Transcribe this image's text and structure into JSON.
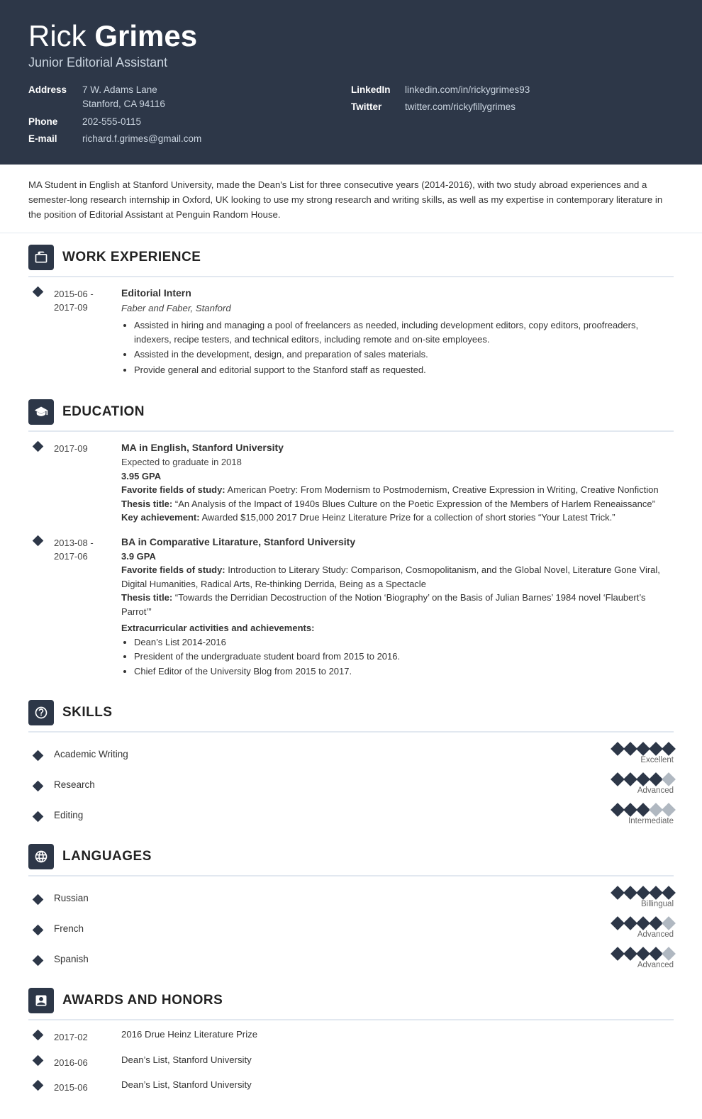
{
  "header": {
    "first_name": "Rick ",
    "last_name": "Grimes",
    "title": "Junior Editorial Assistant",
    "address_label": "Address",
    "address_line1": "7 W. Adams Lane",
    "address_line2": "Stanford, CA 94116",
    "phone_label": "Phone",
    "phone": "202-555-0115",
    "email_label": "E-mail",
    "email": "richard.f.grimes@gmail.com",
    "linkedin_label": "LinkedIn",
    "linkedin": "linkedin.com/in/rickygrimes93",
    "twitter_label": "Twitter",
    "twitter": "twitter.com/rickyfillygrimes"
  },
  "summary": "MA Student in English at Stanford University, made the Dean's List for three consecutive years (2014-2016), with two study abroad experiences and a semester-long research internship in Oxford, UK looking to use my strong research and writing skills, as well as my expertise in contemporary literature in the position of Editorial Assistant at Penguin Random House.",
  "work_experience": {
    "section_title": "WORK EXPERIENCE",
    "entries": [
      {
        "date": "2015-06 -\n2017-09",
        "job_title": "Editorial Intern",
        "company": "Faber and Faber, Stanford",
        "bullets": [
          "Assisted in hiring and managing a pool of freelancers as needed, including development editors, copy editors, proofreaders, indexers, recipe testers, and technical editors, including remote and on-site employees.",
          "Assisted in the development, design, and preparation of sales materials.",
          "Provide general and editorial support to the Stanford staff as requested."
        ]
      }
    ]
  },
  "education": {
    "section_title": "EDUCATION",
    "entries": [
      {
        "date": "2017-09",
        "degree": "MA in English, Stanford University",
        "note": "Expected to graduate in 2018",
        "gpa": "3.95 GPA",
        "fields_label": "Favorite fields of study:",
        "fields": "American Poetry: From Modernism to Postmodernism, Creative Expression in Writing, Creative Nonfiction",
        "thesis_label": "Thesis title:",
        "thesis": "“An Analysis of the Impact of 1940s Blues Culture on the Poetic Expression of the Members of Harlem Reneaissance”",
        "achievement_label": "Key achievement:",
        "achievement": "Awarded $15,000 2017 Drue Heinz Literature Prize for a collection of short stories “Your Latest Trick.”",
        "extra_title": null,
        "extra_bullets": []
      },
      {
        "date": "2013-08 -\n2017-06",
        "degree": "BA in Comparative Litarature, Stanford University",
        "note": null,
        "gpa": "3.9 GPA",
        "fields_label": "Favorite fields of study:",
        "fields": "Introduction to Literary Study: Comparison, Cosmopolitanism, and the Global Novel, Literature Gone Viral, Digital Humanities, Radical Arts, Re-thinking Derrida, Being as a Spectacle",
        "thesis_label": "Thesis title:",
        "thesis": "“Towards the Derridian Decostruction of the Notion ‘Biography’ on the Basis of Julian Barnes’ 1984 novel ‘Flaubert’s Parrot’”",
        "extra_title": "Extracurricular activities and achievements:",
        "extra_bullets": [
          "Dean’s List 2014-2016",
          "President of the undergraduate student board from 2015 to 2016.",
          "Chief Editor of the University Blog from 2015 to 2017."
        ]
      }
    ]
  },
  "skills": {
    "section_title": "SKILLS",
    "entries": [
      {
        "name": "Academic Writing",
        "filled": 5,
        "total": 5,
        "label": "Excellent"
      },
      {
        "name": "Research",
        "filled": 4,
        "total": 5,
        "label": "Advanced"
      },
      {
        "name": "Editing",
        "filled": 3,
        "total": 5,
        "label": "Intermediate"
      }
    ]
  },
  "languages": {
    "section_title": "LANGUAGES",
    "entries": [
      {
        "name": "Russian",
        "filled": 5,
        "total": 5,
        "label": "Billingual"
      },
      {
        "name": "French",
        "filled": 4,
        "total": 5,
        "label": "Advanced"
      },
      {
        "name": "Spanish",
        "filled": 4,
        "total": 5,
        "label": "Advanced"
      }
    ]
  },
  "awards": {
    "section_title": "AWARDS AND HONORS",
    "entries": [
      {
        "date": "2017-02",
        "name": "2016 Drue Heinz Literature Prize"
      },
      {
        "date": "2016-06",
        "name": "Dean’s List, Stanford University"
      },
      {
        "date": "2015-06",
        "name": "Dean’s List, Stanford University"
      }
    ]
  }
}
